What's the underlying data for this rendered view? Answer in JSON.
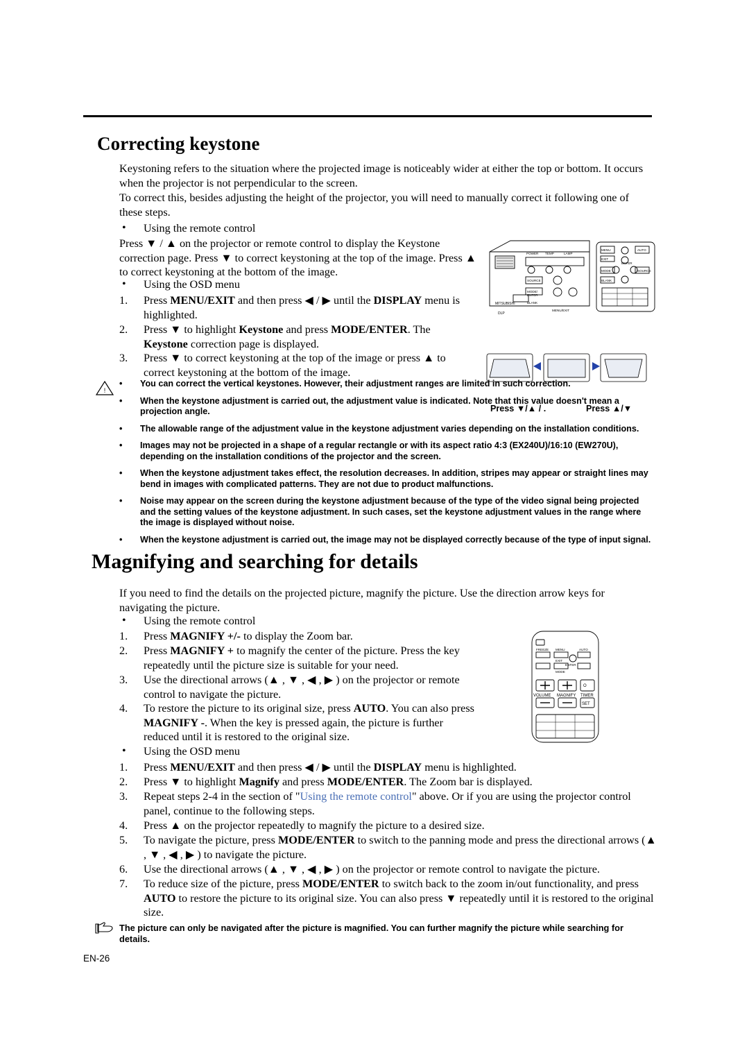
{
  "page": {
    "number": "EN-26"
  },
  "section1": {
    "title": "Correcting keystone",
    "p1": "Keystoning refers to the situation where the projected image is noticeably wider at either the top or bottom. It occurs when the projector is not perpendicular to the screen.",
    "p2": "To correct this, besides adjusting the height of the projector, you will need to manually correct it following one of these steps.",
    "bullet1": "Using the remote control",
    "p3_a": "Press ",
    "p3_b": " / ",
    "p3_c": " on the projector or remote control to display the Keystone correction page. Press ",
    "p3_d": " to correct keystoning at the top of the image. Press ",
    "p3_e": " to correct keystoning at the bottom of the image.",
    "bullet2": "Using the OSD menu",
    "steps": [
      {
        "n": "1.",
        "pre": "Press ",
        "b1": "MENU/EXIT",
        "mid": " and then press ",
        "arrows": " / ",
        "mid2": " until the ",
        "b2": "DISPLAY",
        "post": " menu is highlighted."
      },
      {
        "n": "2.",
        "pre": "Press ",
        "b1": " to highlight ",
        "b2": "Keystone",
        "mid": " and press ",
        "b3": "MODE/ENTER",
        "post": ". The ",
        "b4": "Keystone",
        "post2": " correction page is displayed."
      },
      {
        "n": "3.",
        "pre": "Press ",
        "mid": " to correct keystoning at the top of the image or press ",
        "post": " to correct keystoning at the bottom of the image."
      }
    ],
    "notes": [
      "You can correct the vertical keystones. However, their adjustment ranges are limited in such correction.",
      "When the keystone adjustment is carried out, the adjustment value is indicated. Note that this value doesn't mean a projection angle.",
      "The allowable range of the adjustment value in the keystone adjustment varies depending on the installation conditions.",
      "Images may not be projected in a shape of a regular rectangle or with its aspect ratio 4:3 (EX240U)/16:10 (EW270U), depending on the installation conditions of the projector and the screen.",
      "When the keystone adjustment takes effect, the resolution decreases. In addition, stripes may appear or straight lines may bend in images with complicated patterns. They are not due to product malfunctions.",
      "Noise may appear on the screen during the keystone adjustment because of the type of the video signal being projected and the setting values of the keystone adjustment. In such cases, set the keystone adjustment values in the range where the image is displayed without noise.",
      "When the keystone adjustment is carried out, the image may not be displayed correctly because of the type of input signal."
    ],
    "figure_press_left": "Press",
    "figure_press_left_keys": " / .",
    "figure_press_right": "Press",
    "figure_press_right_keys": " /"
  },
  "section2": {
    "title": "Magnifying and searching for details",
    "p1": "If you need to find the details on the projected picture, magnify the picture. Use the direction arrow keys for navigating the picture.",
    "bullet1": "Using the remote control",
    "remote_steps": [
      {
        "n": "1.",
        "pre": "Press ",
        "b1": "MAGNIFY +/-",
        "post": " to display the Zoom bar."
      },
      {
        "n": "2.",
        "pre": "Press ",
        "b1": "MAGNIFY +",
        "post": " to magnify the center of the picture. Press the key repeatedly until the picture size is suitable for your need."
      },
      {
        "n": "3.",
        "pre": "Use the directional arrows (",
        "post": ") on the projector or remote control to navigate the picture."
      },
      {
        "n": "4.",
        "pre": "To restore the picture to its original size, press ",
        "b1": "AUTO",
        "mid": ". You can also press ",
        "b2": "MAGNIFY -",
        "post": ". When the key is pressed again, the picture is further reduced until it is restored to the original size."
      }
    ],
    "bullet2": "Using the OSD menu",
    "osd_steps": [
      {
        "n": "1.",
        "pre": "Press ",
        "b1": "MENU/EXIT",
        "mid": " and then press ",
        "mid2": " until the ",
        "b2": "DISPLAY",
        "post": " menu is highlighted."
      },
      {
        "n": "2.",
        "pre": "Press ",
        "mid": " to highlight ",
        "b1": "Magnify",
        "mid2": " and press ",
        "b2": "MODE/ENTER",
        "post": ". The Zoom bar is displayed."
      },
      {
        "n": "3.",
        "pre": "Repeat steps 2-4 in the section of \"",
        "link": "Using the remote control",
        "post": "\" above. Or if you are using the projector control panel, continue to the following steps."
      },
      {
        "n": "4.",
        "pre": "Press ",
        "post": " on the projector repeatedly to magnify the picture to a desired size."
      },
      {
        "n": "5.",
        "pre": "To navigate the picture, press ",
        "b1": "MODE/ENTER",
        "post": " to switch to the panning mode and press the directional arrows (",
        "post2": ") to navigate the picture."
      },
      {
        "n": "6.",
        "pre": "Use the directional arrows (",
        "post": ") on the projector or remote control to navigate the picture."
      },
      {
        "n": "7.",
        "pre": "To reduce size of the picture, press ",
        "b1": "MODE/ENTER",
        "mid": " to switch back to the zoom in/out functionality, and press ",
        "b2": "AUTO",
        "mid2": " to restore the picture to its original size. You can also press ",
        "post": " repeatedly until it is restored to the original size."
      }
    ],
    "footer_note": "The picture can only be navigated after the picture is magnified. You can further magnify the picture while searching for details."
  },
  "projector_figure": {
    "labels": [
      "POWER",
      "TEMP",
      "LAMP",
      "SOURCE",
      "AUTO",
      "MODE/",
      "ENTER",
      "BLANK",
      "MENU/EXIT",
      "MITSUBISHI",
      "DLP"
    ],
    "remote_labels": [
      "MENU",
      "AUTO",
      "EXIT",
      "MODE",
      "BLANK",
      "SOURCE",
      "ENTER"
    ]
  },
  "remote_figure": {
    "labels": [
      "FREEZE",
      "MENU",
      "EXIT",
      "AUTO",
      "MODE",
      "ENTER",
      "VOLUME",
      "MAGNIFY",
      "TIMER",
      "SET"
    ]
  }
}
